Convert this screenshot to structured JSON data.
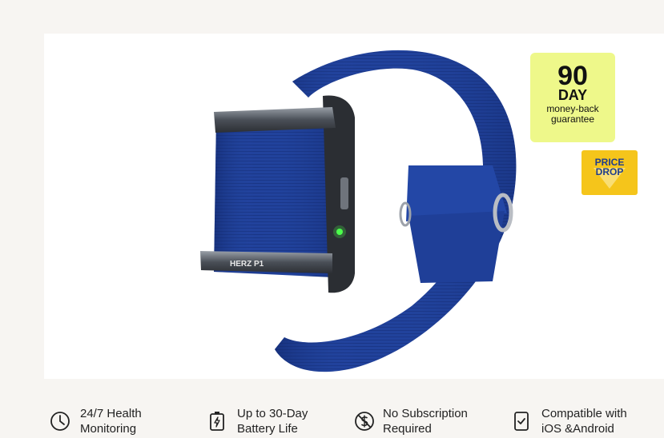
{
  "product": {
    "image_alt": "Blue nylon loop band fitness tracker",
    "device_engraving": "HERZ P1"
  },
  "badges": {
    "guarantee": {
      "number": "90",
      "unit": "DAY",
      "line1": "money-back",
      "line2": "guarantee"
    },
    "price_drop": {
      "line1": "PRICE",
      "line2": "DROP"
    }
  },
  "features": [
    {
      "icon": "clock-icon",
      "line1": "24/7 Health",
      "line2": "Monitoring"
    },
    {
      "icon": "battery-icon",
      "line1": "Up to 30-Day",
      "line2": "Battery Life"
    },
    {
      "icon": "no-dollar-icon",
      "line1": "No Subscription",
      "line2": "Required"
    },
    {
      "icon": "phone-check-icon",
      "line1": "Compatible with",
      "line2": "iOS &Android"
    }
  ],
  "colors": {
    "band": "#1f3f9a",
    "guarantee_badge": "#eef88a",
    "price_badge": "#f5c51b",
    "price_text": "#1f3d8c"
  }
}
